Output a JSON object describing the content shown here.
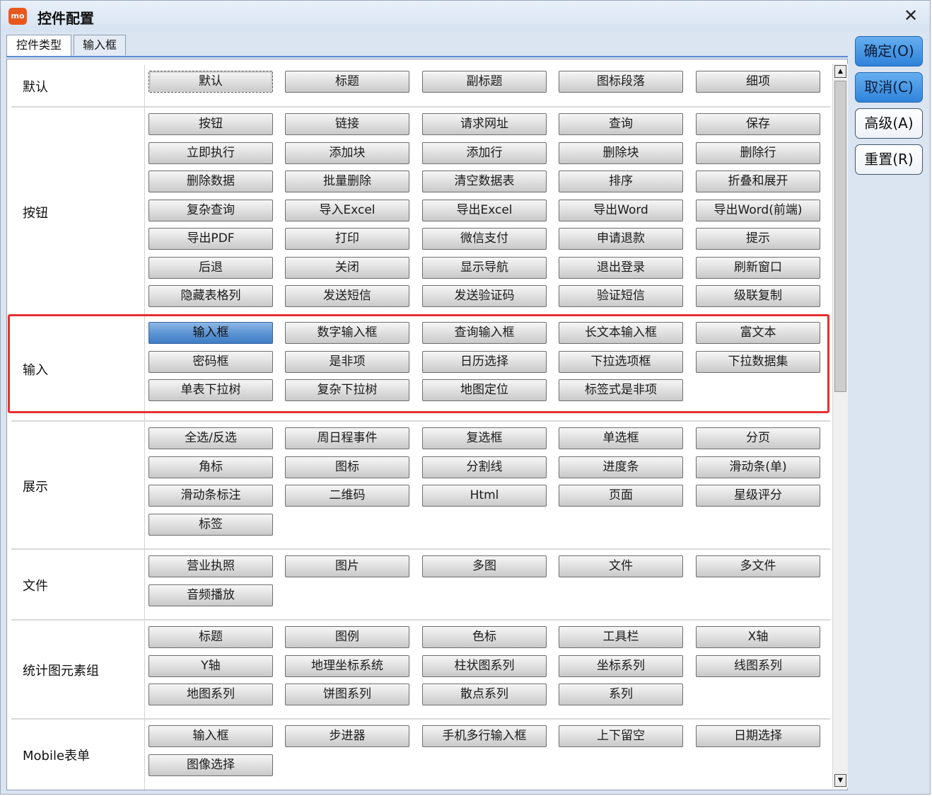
{
  "window": {
    "title": "控件配置",
    "app_icon_text": "mo",
    "close_symbol": "✕"
  },
  "tabs": [
    {
      "label": "控件类型",
      "active": true
    },
    {
      "label": "输入框",
      "active": false
    }
  ],
  "side_buttons": [
    {
      "label": "确定(O)",
      "style": "primary"
    },
    {
      "label": "取消(C)",
      "style": "primary"
    },
    {
      "label": "高级(A)",
      "style": "plain"
    },
    {
      "label": "重置(R)",
      "style": "plain"
    }
  ],
  "sections": [
    {
      "label": "默认",
      "buttons": [
        "默认",
        "标题",
        "副标题",
        "图标段落",
        "细项"
      ]
    },
    {
      "label": "按钮",
      "buttons": [
        "按钮",
        "链接",
        "请求网址",
        "查询",
        "保存",
        "立即执行",
        "添加块",
        "添加行",
        "删除块",
        "删除行",
        "删除数据",
        "批量删除",
        "清空数据表",
        "排序",
        "折叠和展开",
        "复杂查询",
        "导入Excel",
        "导出Excel",
        "导出Word",
        "导出Word(前端)",
        "导出PDF",
        "打印",
        "微信支付",
        "申请退款",
        "提示",
        "后退",
        "关闭",
        "显示导航",
        "退出登录",
        "刷新窗口",
        "隐藏表格列",
        "发送短信",
        "发送验证码",
        "验证短信",
        "级联复制"
      ]
    },
    {
      "label": "输入",
      "buttons": [
        "输入框",
        "数字输入框",
        "查询输入框",
        "长文本输入框",
        "富文本",
        "密码框",
        "是非项",
        "日历选择",
        "下拉选项框",
        "下拉数据集",
        "单表下拉树",
        "复杂下拉树",
        "地图定位",
        "标签式是非项"
      ]
    },
    {
      "label": "展示",
      "buttons": [
        "全选/反选",
        "周日程事件",
        "复选框",
        "单选框",
        "分页",
        "角标",
        "图标",
        "分割线",
        "进度条",
        "滑动条(单)",
        "滑动条标注",
        "二维码",
        "Html",
        "页面",
        "星级评分",
        "标签"
      ]
    },
    {
      "label": "文件",
      "buttons": [
        "营业执照",
        "图片",
        "多图",
        "文件",
        "多文件",
        "音频播放"
      ]
    },
    {
      "label": "统计图元素组",
      "buttons": [
        "标题",
        "图例",
        "色标",
        "工具栏",
        "X轴",
        "Y轴",
        "地理坐标系统",
        "柱状图系列",
        "坐标系列",
        "线图系列",
        "地图系列",
        "饼图系列",
        "散点系列",
        "系列"
      ]
    },
    {
      "label": "Mobile表单",
      "buttons": [
        "输入框",
        "步进器",
        "手机多行输入框",
        "上下留空",
        "日期选择",
        "图像选择"
      ]
    }
  ],
  "selected": {
    "section": 2,
    "button": 0
  },
  "default_focus": {
    "section": 0,
    "button": 0
  },
  "highlighted_section": 2,
  "colors": {
    "highlight_border": "#e53030",
    "selected_button": "#5e95d4",
    "primary_button": "#2f83da"
  },
  "scrollbar": {
    "up_arrow": "▲",
    "down_arrow": "▼"
  }
}
